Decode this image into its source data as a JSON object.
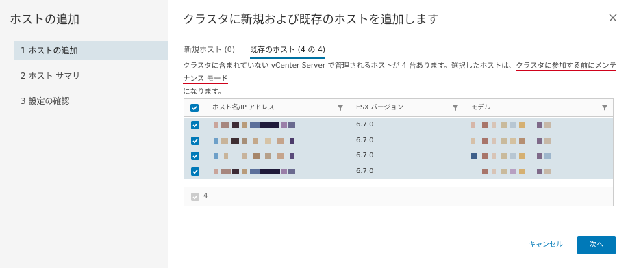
{
  "sidebar": {
    "title": "ホストの追加",
    "steps": [
      {
        "label": "1 ホストの追加"
      },
      {
        "label": "2 ホスト サマリ"
      },
      {
        "label": "3 設定の確認"
      }
    ]
  },
  "main": {
    "title": "クラスタに新規および既存のホストを追加します",
    "tabs": [
      {
        "label": "新規ホスト (0)"
      },
      {
        "label": "既存のホスト (4 の 4)"
      }
    ],
    "description": {
      "part1": "クラスタに含まれていない vCenter Server で管理されるホストが 4 台あります。選択したホストは、",
      "emphasis": "クラスタに参加する前にメンテナンス モード",
      "part2": "になります。"
    }
  },
  "grid": {
    "columns": [
      "ホスト名/IP アドレス",
      "ESX バージョン",
      "モデル"
    ],
    "rows": [
      {
        "esx": "6.7.0"
      },
      {
        "esx": "6.7.0"
      },
      {
        "esx": "6.7.0"
      },
      {
        "esx": "6.7.0"
      }
    ],
    "footer_count": "4"
  },
  "buttons": {
    "cancel": "キャンセル",
    "next": "次へ"
  },
  "colors": {
    "accent": "#0079b8",
    "selected_row": "#d8e3e9",
    "annotation_underline": "#d0021b"
  }
}
